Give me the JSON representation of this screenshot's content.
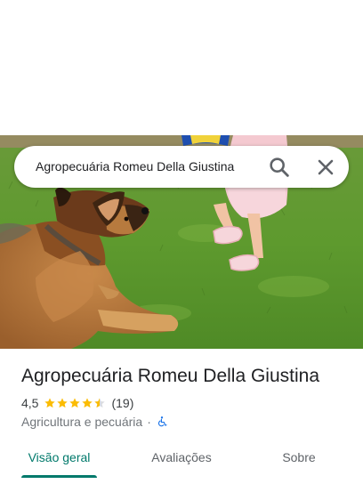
{
  "search": {
    "query": "Agropecuária Romeu Della Giustina",
    "search_icon": "search-icon",
    "close_icon": "close-icon"
  },
  "hero": {
    "photo": "photo of a german shepherd dog lying on grass next to a child"
  },
  "place": {
    "title": "Agropecuária Romeu Della Giustina",
    "rating": "4,5",
    "rating_stars": 4.5,
    "review_count": "(19)",
    "category": "Agricultura e pecuária",
    "separator": "·",
    "accessibility_icon": "wheelchair-accessible-icon"
  },
  "tabs": [
    {
      "label": "Visão geral",
      "active": true
    },
    {
      "label": "Avaliações",
      "active": false
    },
    {
      "label": "Sobre",
      "active": false
    }
  ],
  "colors": {
    "accent": "#00796b",
    "star": "#fbbc04",
    "accessibility": "#1a73e8"
  }
}
